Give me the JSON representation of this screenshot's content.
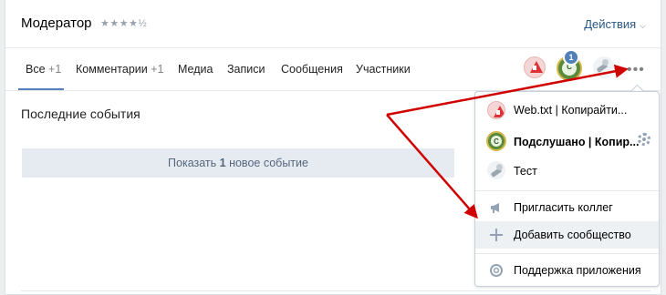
{
  "header": {
    "title": "Модератор",
    "rating": "★★★★½",
    "actions_label": "Действия",
    "actions_chevron": "⌵"
  },
  "tabs": [
    {
      "label": "Все",
      "count": "+1",
      "active": true
    },
    {
      "label": "Комментарии",
      "count": "+1"
    },
    {
      "label": "Медиа"
    },
    {
      "label": "Записи"
    },
    {
      "label": "Сообщения"
    },
    {
      "label": "Участники"
    }
  ],
  "community_icons": {
    "badge_count": "1",
    "more_label": "•••"
  },
  "main": {
    "section_title": "Последние события",
    "show_new_prefix": "Показать ",
    "show_new_count": "1",
    "show_new_suffix": " новое событие"
  },
  "menu": {
    "communities": [
      {
        "label": "Web.txt | Копирайти...",
        "icon": "warning-sign-icon"
      },
      {
        "label": "Подслушано | Копир...",
        "icon": "podslushano-logo-icon",
        "bold": true
      },
      {
        "label": "Тест",
        "icon": "satellite-dish-icon"
      }
    ],
    "invite_label": "Пригласить коллег",
    "add_label": "Добавить сообщество",
    "support_label": "Поддержка приложения"
  },
  "colors": {
    "accent": "#5181b8",
    "link": "#2a5885",
    "arrow": "#d10000",
    "button_bg": "#e5ebf1"
  }
}
